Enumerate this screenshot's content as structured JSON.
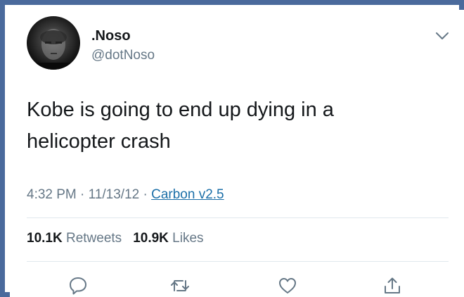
{
  "user": {
    "display_name": ".Noso",
    "handle": "@dotNoso"
  },
  "tweet": {
    "text_line1": "Kobe is going to end up dying in a",
    "text_line2": "helicopter crash",
    "time": "4:32 PM",
    "date": "11/13/12",
    "source": "Carbon v2.5",
    "separator": " · "
  },
  "stats": {
    "retweets_count": "10.1K",
    "retweets_label": "Retweets",
    "likes_count": "10.9K",
    "likes_label": "Likes"
  },
  "icons": {
    "menu": "chevron-down-icon",
    "reply": "reply-icon",
    "retweet": "retweet-icon",
    "like": "heart-icon",
    "share": "share-icon"
  },
  "colors": {
    "frame": "#4a6a9c",
    "text": "#14171a",
    "muted": "#657786",
    "link": "#1b6fa8",
    "divider": "#e1e8ed"
  }
}
